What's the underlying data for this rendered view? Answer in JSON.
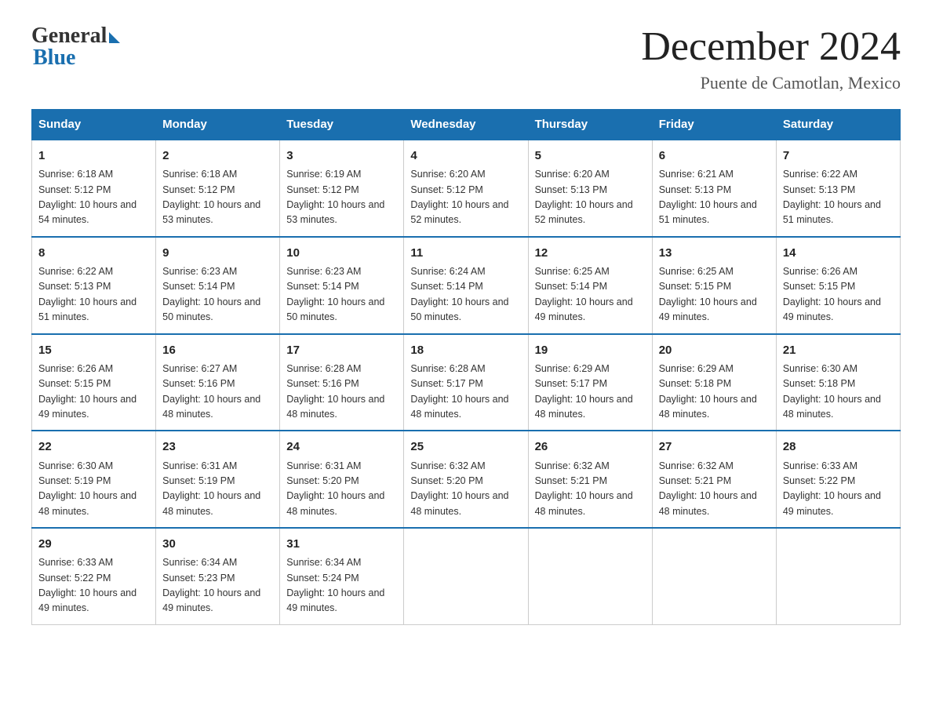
{
  "logo": {
    "general": "General",
    "blue": "Blue"
  },
  "header": {
    "month": "December 2024",
    "location": "Puente de Camotlan, Mexico"
  },
  "days_of_week": [
    "Sunday",
    "Monday",
    "Tuesday",
    "Wednesday",
    "Thursday",
    "Friday",
    "Saturday"
  ],
  "weeks": [
    [
      {
        "day": "1",
        "sunrise": "6:18 AM",
        "sunset": "5:12 PM",
        "daylight": "10 hours and 54 minutes."
      },
      {
        "day": "2",
        "sunrise": "6:18 AM",
        "sunset": "5:12 PM",
        "daylight": "10 hours and 53 minutes."
      },
      {
        "day": "3",
        "sunrise": "6:19 AM",
        "sunset": "5:12 PM",
        "daylight": "10 hours and 53 minutes."
      },
      {
        "day": "4",
        "sunrise": "6:20 AM",
        "sunset": "5:12 PM",
        "daylight": "10 hours and 52 minutes."
      },
      {
        "day": "5",
        "sunrise": "6:20 AM",
        "sunset": "5:13 PM",
        "daylight": "10 hours and 52 minutes."
      },
      {
        "day": "6",
        "sunrise": "6:21 AM",
        "sunset": "5:13 PM",
        "daylight": "10 hours and 51 minutes."
      },
      {
        "day": "7",
        "sunrise": "6:22 AM",
        "sunset": "5:13 PM",
        "daylight": "10 hours and 51 minutes."
      }
    ],
    [
      {
        "day": "8",
        "sunrise": "6:22 AM",
        "sunset": "5:13 PM",
        "daylight": "10 hours and 51 minutes."
      },
      {
        "day": "9",
        "sunrise": "6:23 AM",
        "sunset": "5:14 PM",
        "daylight": "10 hours and 50 minutes."
      },
      {
        "day": "10",
        "sunrise": "6:23 AM",
        "sunset": "5:14 PM",
        "daylight": "10 hours and 50 minutes."
      },
      {
        "day": "11",
        "sunrise": "6:24 AM",
        "sunset": "5:14 PM",
        "daylight": "10 hours and 50 minutes."
      },
      {
        "day": "12",
        "sunrise": "6:25 AM",
        "sunset": "5:14 PM",
        "daylight": "10 hours and 49 minutes."
      },
      {
        "day": "13",
        "sunrise": "6:25 AM",
        "sunset": "5:15 PM",
        "daylight": "10 hours and 49 minutes."
      },
      {
        "day": "14",
        "sunrise": "6:26 AM",
        "sunset": "5:15 PM",
        "daylight": "10 hours and 49 minutes."
      }
    ],
    [
      {
        "day": "15",
        "sunrise": "6:26 AM",
        "sunset": "5:15 PM",
        "daylight": "10 hours and 49 minutes."
      },
      {
        "day": "16",
        "sunrise": "6:27 AM",
        "sunset": "5:16 PM",
        "daylight": "10 hours and 48 minutes."
      },
      {
        "day": "17",
        "sunrise": "6:28 AM",
        "sunset": "5:16 PM",
        "daylight": "10 hours and 48 minutes."
      },
      {
        "day": "18",
        "sunrise": "6:28 AM",
        "sunset": "5:17 PM",
        "daylight": "10 hours and 48 minutes."
      },
      {
        "day": "19",
        "sunrise": "6:29 AM",
        "sunset": "5:17 PM",
        "daylight": "10 hours and 48 minutes."
      },
      {
        "day": "20",
        "sunrise": "6:29 AM",
        "sunset": "5:18 PM",
        "daylight": "10 hours and 48 minutes."
      },
      {
        "day": "21",
        "sunrise": "6:30 AM",
        "sunset": "5:18 PM",
        "daylight": "10 hours and 48 minutes."
      }
    ],
    [
      {
        "day": "22",
        "sunrise": "6:30 AM",
        "sunset": "5:19 PM",
        "daylight": "10 hours and 48 minutes."
      },
      {
        "day": "23",
        "sunrise": "6:31 AM",
        "sunset": "5:19 PM",
        "daylight": "10 hours and 48 minutes."
      },
      {
        "day": "24",
        "sunrise": "6:31 AM",
        "sunset": "5:20 PM",
        "daylight": "10 hours and 48 minutes."
      },
      {
        "day": "25",
        "sunrise": "6:32 AM",
        "sunset": "5:20 PM",
        "daylight": "10 hours and 48 minutes."
      },
      {
        "day": "26",
        "sunrise": "6:32 AM",
        "sunset": "5:21 PM",
        "daylight": "10 hours and 48 minutes."
      },
      {
        "day": "27",
        "sunrise": "6:32 AM",
        "sunset": "5:21 PM",
        "daylight": "10 hours and 48 minutes."
      },
      {
        "day": "28",
        "sunrise": "6:33 AM",
        "sunset": "5:22 PM",
        "daylight": "10 hours and 49 minutes."
      }
    ],
    [
      {
        "day": "29",
        "sunrise": "6:33 AM",
        "sunset": "5:22 PM",
        "daylight": "10 hours and 49 minutes."
      },
      {
        "day": "30",
        "sunrise": "6:34 AM",
        "sunset": "5:23 PM",
        "daylight": "10 hours and 49 minutes."
      },
      {
        "day": "31",
        "sunrise": "6:34 AM",
        "sunset": "5:24 PM",
        "daylight": "10 hours and 49 minutes."
      },
      null,
      null,
      null,
      null
    ]
  ]
}
